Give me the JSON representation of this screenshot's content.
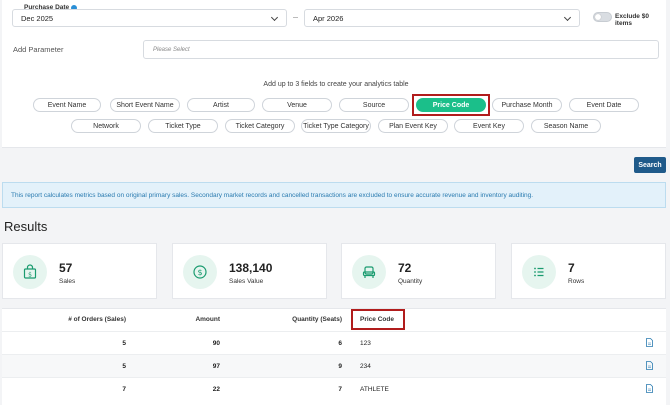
{
  "filters": {
    "purchase_date_label": "Purchase Date",
    "start_date": "Dec 2025",
    "end_date": "Apr 2026",
    "exclude_zero_label": "Exclude $0 items",
    "add_parameter_label": "Add Parameter",
    "parameter_placeholder": "Please Select",
    "hint": "Add up to 3 fields to create your analytics table"
  },
  "chips_row1": [
    "Event Name",
    "Short Event Name",
    "Artist",
    "Venue",
    "Source",
    "Price Code",
    "Purchase Month",
    "Event Date"
  ],
  "chips_row2": [
    "Network",
    "Ticket Type",
    "Ticket Category",
    "Ticket Type Category",
    "Plan Event Key",
    "Event Key",
    "Season Name"
  ],
  "active_chip": "Price Code",
  "search_label": "Search",
  "notice": "This report calculates metrics based on original primary sales. Secondary market records and cancelled transactions are excluded to ensure accurate revenue and inventory auditing.",
  "results_title": "Results",
  "stats": [
    {
      "value": "57",
      "label": "Sales",
      "icon": "shopping-bag-dollar-icon"
    },
    {
      "value": "138,140",
      "label": "Sales Value",
      "icon": "dollar-circle-icon"
    },
    {
      "value": "72",
      "label": "Quantity",
      "icon": "seat-icon"
    },
    {
      "value": "7",
      "label": "Rows",
      "icon": "list-icon"
    }
  ],
  "table": {
    "headers": [
      "# of Orders (Sales)",
      "Amount",
      "Quantity (Seats)",
      "Price Code"
    ],
    "rows": [
      [
        "5",
        "90",
        "6",
        "123"
      ],
      [
        "5",
        "97",
        "9",
        "234"
      ],
      [
        "7",
        "22",
        "7",
        "ATHLETE"
      ]
    ]
  },
  "colors": {
    "accent": "#1bbf8a",
    "primary_button": "#1f5a8a",
    "highlight": "#b11c1c"
  }
}
